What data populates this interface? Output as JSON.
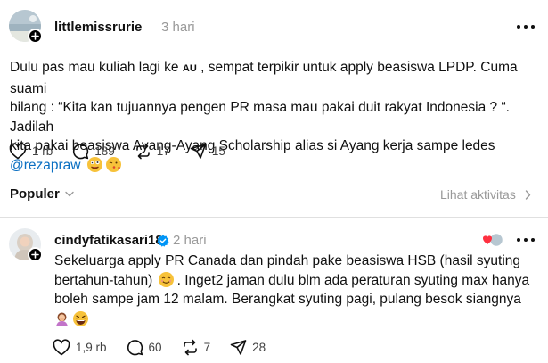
{
  "post1": {
    "username": "littlemissrurie",
    "time": "3 hari",
    "text_line1_a": "Dulu pas mau kuliah lagi ke",
    "text_au": "AU",
    "text_line1_b": ", sempat terpikir untuk apply beasiswa LPDP. Cuma suami",
    "text_line2": "bilang : “Kita kan tujuannya pengen PR masa mau pakai duit rakyat Indonesia ? “. Jadilah",
    "text_line3": "kita pakai beasiswa Ayang-Ayang Scholarship alias si Ayang kerja sampe ledes",
    "mention": "@rezapraw",
    "likes": "1 rb",
    "comments": "189",
    "reposts": "17",
    "shares": "15"
  },
  "sort": {
    "label": "Populer",
    "activity_label": "Lihat aktivitas"
  },
  "post2": {
    "username": "cindyfatikasari18",
    "time": "2 hari",
    "text_line1": "Sekeluarga apply PR Canada dan pindah pake beasiswa HSB (hasil syuting",
    "text_line2a": "bertahun-tahun)",
    "text_line2b": ". Inget2 jaman dulu blm ada peraturan syuting max hanya",
    "text_line3": "boleh sampe jam 12 malam. Berangkat syuting pagi, pulang besok siangnya",
    "likes": "1,9 rb",
    "comments": "60",
    "reposts": "7",
    "shares": "28"
  },
  "colors": {
    "mention": "#0a6fc2",
    "verified": "#0095f6",
    "liked_heart": "#ff3040",
    "muted": "#999999"
  },
  "icons": [
    "more-icon",
    "heart-icon",
    "comment-icon",
    "repost-icon",
    "share-icon",
    "chevron-down-icon",
    "chevron-right-icon",
    "verified-icon",
    "plus-icon"
  ]
}
